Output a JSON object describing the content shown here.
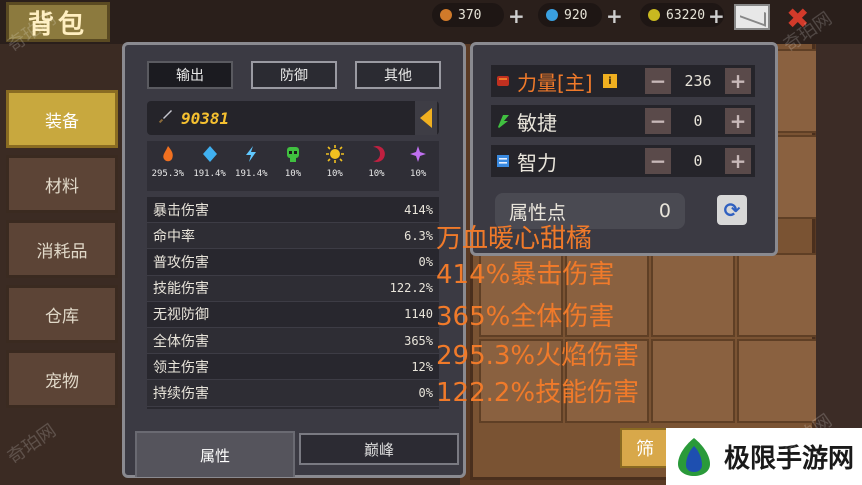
{
  "header": {
    "title": "背包",
    "resources": [
      {
        "name": "fire-resource",
        "value": "370",
        "color": "#d07a2a"
      },
      {
        "name": "gem-resource",
        "value": "920",
        "color": "#3aa0e0"
      },
      {
        "name": "gold-resource",
        "value": "63220",
        "color": "#c8b820"
      }
    ]
  },
  "sidebar": {
    "items": [
      {
        "label": "装备",
        "active": true
      },
      {
        "label": "材料",
        "active": false
      },
      {
        "label": "消耗品",
        "active": false
      },
      {
        "label": "仓库",
        "active": false
      },
      {
        "label": "宠物",
        "active": false
      }
    ]
  },
  "attr_panel": {
    "tabs": [
      "输出",
      "防御",
      "其他"
    ],
    "power": "90381",
    "elements": [
      {
        "icon": "fire-icon",
        "value": "295.3%",
        "color": "#f07020"
      },
      {
        "icon": "ice-crystal-icon",
        "value": "191.4%",
        "color": "#40b0f0"
      },
      {
        "icon": "lightning-icon",
        "value": "191.4%",
        "color": "#60c8ff"
      },
      {
        "icon": "poison-skull-icon",
        "value": "10%",
        "color": "#40c040"
      },
      {
        "icon": "sun-icon",
        "value": "10%",
        "color": "#f0c020"
      },
      {
        "icon": "dark-moon-icon",
        "value": "10%",
        "color": "#c02040"
      },
      {
        "icon": "arcane-star-icon",
        "value": "10%",
        "color": "#c070f0"
      }
    ],
    "stats": [
      {
        "label": "暴击伤害",
        "value": "414%"
      },
      {
        "label": "命中率",
        "value": "6.3%"
      },
      {
        "label": "普攻伤害",
        "value": "0%"
      },
      {
        "label": "技能伤害",
        "value": "122.2%"
      },
      {
        "label": "无视防御",
        "value": "1140"
      },
      {
        "label": "全体伤害",
        "value": "365%"
      },
      {
        "label": "领主伤害",
        "value": "12%"
      },
      {
        "label": "持续伤害",
        "value": "0%"
      }
    ],
    "bottom_tabs": [
      "属性",
      "巅峰"
    ]
  },
  "attr_points": {
    "rows": [
      {
        "label": "力量[主]",
        "value": "236",
        "color": "#f07a2a",
        "icon": "strength-fist-icon"
      },
      {
        "label": "敏捷",
        "value": "0",
        "color": "#e8e4da",
        "icon": "agility-boot-icon"
      },
      {
        "label": "智力",
        "value": "0",
        "color": "#e8e4da",
        "icon": "intellect-book-icon"
      }
    ],
    "points_label": "属性点",
    "points_value": "0",
    "minus": "−",
    "plus": "+"
  },
  "overlay_text": [
    "万血暖心甜橘",
    "414%暴击伤害",
    "365%全体伤害",
    "295.3%火焰伤害",
    "122.2%技能伤害"
  ],
  "bottom": {
    "sort_label": "筛",
    "logo_text": "极限手游网"
  },
  "watermark": "奇珀网"
}
